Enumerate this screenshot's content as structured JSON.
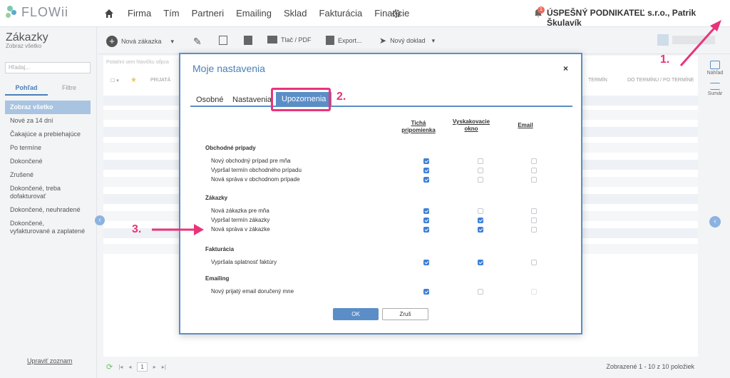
{
  "app": {
    "logo": "FLOWii"
  },
  "nav": [
    "Firma",
    "Tím",
    "Partneri",
    "Emailing",
    "Sklad",
    "Fakturácia",
    "Financie"
  ],
  "header": {
    "notification_count": "1",
    "company": "ÚSPEŠNÝ PODNIKATEĽ s.r.o., Patrik Škulavík"
  },
  "sidebar": {
    "title": "Zákazky",
    "subtitle": "Zobraz všetko",
    "search_placeholder": "Hľadaj...",
    "tab_view": "Pohľad",
    "tab_filters": "Filtre",
    "items": [
      "Zobraz všetko",
      "Nové za 14 dní",
      "Čakajúce a prebiehajúce",
      "Po termíne",
      "Dokončené",
      "Zrušené",
      "Dokončené, treba dofakturovať",
      "Dokončené, neuhradené",
      "Dokončené, vyfakturované a zaplatené"
    ],
    "edit_link": "Upraviť zoznam"
  },
  "toolbar": {
    "new_order": "Nová zákazka",
    "print": "Tlač / PDF",
    "export": "Export...",
    "new_document": "Nový doklad"
  },
  "table": {
    "drag_hint": "Potiahni sem hlavičku stĺpca",
    "col_received": "PRIJATÁ",
    "col_term": "TERMÍN",
    "col_after": "DO TERMÍNU / PO TERMÍNE"
  },
  "right_rail": {
    "preview": "Náhľad",
    "summary": "Sumár"
  },
  "footer": {
    "page": "1",
    "count": "Zobrazené 1 - 10 z 10 položiek"
  },
  "modal": {
    "title": "Moje nastavenia",
    "close": "×",
    "tabs": [
      "Osobné",
      "Nastavenia",
      "Upozornenia"
    ],
    "columns": [
      "Tichá pripomienka",
      "Vyskakovacie okno",
      "Email"
    ],
    "sections": [
      {
        "title": "Obchodné prípady",
        "rows": [
          {
            "label": "Nový obchodný prípad pre mňa",
            "checks": [
              true,
              false,
              false
            ]
          },
          {
            "label": "Vypršal termín obchodného prípadu",
            "checks": [
              true,
              false,
              false
            ]
          },
          {
            "label": "Nová správa v obchodnom prípade",
            "checks": [
              true,
              false,
              false
            ]
          }
        ]
      },
      {
        "title": "Zákazky",
        "rows": [
          {
            "label": "Nová zákazka pre mňa",
            "checks": [
              true,
              false,
              false
            ]
          },
          {
            "label": "Vypršal termín zákazky",
            "checks": [
              true,
              true,
              false
            ]
          },
          {
            "label": "Nová správa v zákazke",
            "checks": [
              true,
              true,
              false
            ]
          }
        ]
      },
      {
        "title": "Fakturácia",
        "rows": [
          {
            "label": "Vypršala splatnosť faktúry",
            "checks": [
              true,
              true,
              false
            ]
          }
        ]
      },
      {
        "title": "Emailing",
        "rows": [
          {
            "label": "Nový prijatý email doručený mne",
            "checks": [
              true,
              false,
              false
            ]
          }
        ]
      }
    ],
    "ok": "OK",
    "cancel": "Zruš"
  },
  "annotations": {
    "one": "1.",
    "two": "2.",
    "three": "3."
  },
  "colors": {
    "accent": "#5b8ec7",
    "highlight": "#e8347a",
    "checkbox": "#3d7fd6"
  }
}
